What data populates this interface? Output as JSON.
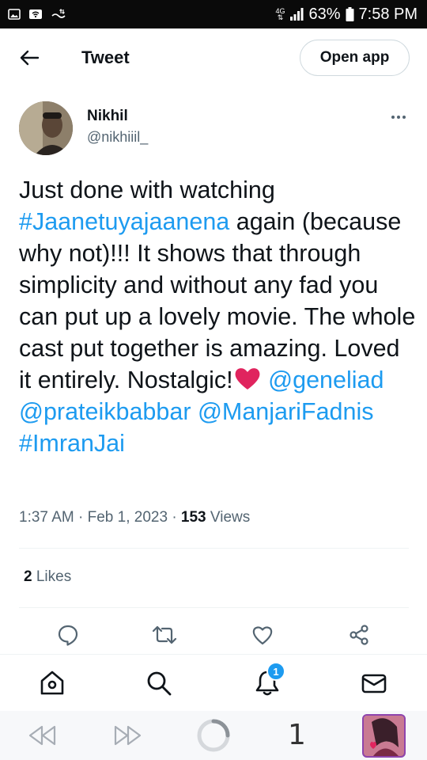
{
  "status_bar": {
    "network": "4G",
    "battery": "63%",
    "time": "7:58 PM"
  },
  "header": {
    "back_icon": "arrow-left-icon",
    "title": "Tweet",
    "open_app_label": "Open app"
  },
  "tweet": {
    "author_name": "Nikhil",
    "author_handle": "@nikhiiil_",
    "text_parts": {
      "p1": "Just done with watching ",
      "hashtag1": "#Jaanetuyajaanena",
      "p2": " again (because why not)!!! It shows that through simplicity and without any fad you can put up a lovely movie. The whole cast put together is amazing. Loved it entirely. Nostalgic!",
      "mention1": "@geneliad",
      "mention2": "@prateikbabbar",
      "mention3": "@ManjariFadnis",
      "hashtag2": "#ImranJai"
    },
    "emoji": "red-heart-emoji",
    "time": "1:37 AM",
    "date": "Feb 1, 2023",
    "separator": "·",
    "views_count": "153",
    "views_label": "Views",
    "likes_count": "2",
    "likes_label": "Likes"
  },
  "actions": [
    "reply-icon",
    "retweet-icon",
    "like-icon",
    "share-icon"
  ],
  "bottom_nav": {
    "items": [
      "home-icon",
      "search-icon",
      "notifications-icon",
      "messages-icon"
    ],
    "notification_badge": "1"
  },
  "browser_bar": {
    "tab_count": "1"
  },
  "colors": {
    "accent": "#1d9bf0",
    "text": "#0f1419",
    "secondary": "#536471",
    "heart": "#e0245e"
  }
}
